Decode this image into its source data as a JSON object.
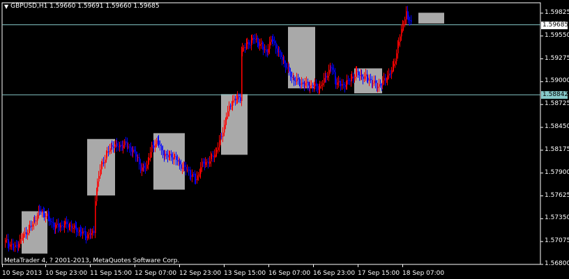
{
  "header": {
    "dropdown_icon": "triangle-down-icon",
    "title": "GBPUSD,H1  1.59660 1.59691 1.59660 1.59685"
  },
  "copyright": "MetaTrader 4, ? 2001-2013, MetaQuotes Software Corp.",
  "price_axis": {
    "ticks": [
      "1.59825",
      "1.59550",
      "1.59275",
      "1.59000",
      "1.58725",
      "1.58450",
      "1.58175",
      "1.57900",
      "1.57625",
      "1.57350",
      "1.57075",
      "1.56800"
    ],
    "current_price": "1.59685",
    "level_price": "1.58842"
  },
  "time_axis": {
    "ticks": [
      "10 Sep 2013",
      "10 Sep 23:00",
      "11 Sep 15:00",
      "12 Sep 07:00",
      "12 Sep 23:00",
      "13 Sep 15:00",
      "16 Sep 07:00",
      "16 Sep 23:00",
      "17 Sep 15:00",
      "18 Sep 07:00"
    ]
  },
  "colors": {
    "background": "#000000",
    "bull_candle": "#ff0000",
    "bear_candle": "#0000ff",
    "range_box": "#a9a9a9",
    "horizontal_line": "#86c8c8",
    "axis": "#ffffff"
  },
  "chart_data": {
    "type": "candlestick",
    "symbol": "GBPUSD",
    "timeframe": "H1",
    "ylim": [
      1.568,
      1.5995
    ],
    "x": [
      "10 Sep 2013",
      "10 Sep 23:00",
      "11 Sep 15:00",
      "12 Sep 07:00",
      "12 Sep 23:00",
      "13 Sep 15:00",
      "16 Sep 07:00",
      "16 Sep 23:00",
      "17 Sep 15:00",
      "18 Sep 07:00"
    ],
    "anchors": [
      [
        0,
        1.5708
      ],
      [
        8,
        1.57
      ],
      [
        15,
        1.5715
      ],
      [
        22,
        1.5728
      ],
      [
        28,
        1.5745
      ],
      [
        34,
        1.5738
      ],
      [
        40,
        1.5725
      ],
      [
        50,
        1.5728
      ],
      [
        58,
        1.5722
      ],
      [
        66,
        1.5715
      ],
      [
        72,
        1.5718
      ],
      [
        73,
        1.576
      ],
      [
        77,
        1.5795
      ],
      [
        82,
        1.5812
      ],
      [
        87,
        1.5824
      ],
      [
        92,
        1.5822
      ],
      [
        98,
        1.5825
      ],
      [
        104,
        1.5815
      ],
      [
        108,
        1.5808
      ],
      [
        110,
        1.5795
      ],
      [
        112,
        1.5795
      ],
      [
        115,
        1.58
      ],
      [
        119,
        1.582
      ],
      [
        124,
        1.583
      ],
      [
        127,
        1.5815
      ],
      [
        132,
        1.581
      ],
      [
        137,
        1.581
      ],
      [
        142,
        1.58
      ],
      [
        146,
        1.5796
      ],
      [
        150,
        1.579
      ],
      [
        155,
        1.5782
      ],
      [
        160,
        1.58
      ],
      [
        166,
        1.5805
      ],
      [
        171,
        1.5815
      ],
      [
        176,
        1.5835
      ],
      [
        180,
        1.586
      ],
      [
        185,
        1.5878
      ],
      [
        191,
        1.588
      ],
      [
        192,
        1.5938
      ],
      [
        197,
        1.5945
      ],
      [
        202,
        1.5952
      ],
      [
        207,
        1.5946
      ],
      [
        212,
        1.5935
      ],
      [
        217,
        1.5952
      ],
      [
        222,
        1.5935
      ],
      [
        228,
        1.592
      ],
      [
        233,
        1.5905
      ],
      [
        238,
        1.59
      ],
      [
        243,
        1.5897
      ],
      [
        249,
        1.5895
      ],
      [
        256,
        1.5893
      ],
      [
        260,
        1.5905
      ],
      [
        265,
        1.5918
      ],
      [
        269,
        1.59
      ],
      [
        274,
        1.5895
      ],
      [
        279,
        1.59
      ],
      [
        285,
        1.591
      ],
      [
        290,
        1.5907
      ],
      [
        296,
        1.5903
      ],
      [
        302,
        1.5895
      ],
      [
        306,
        1.5897
      ],
      [
        310,
        1.5905
      ],
      [
        315,
        1.5915
      ],
      [
        318,
        1.5935
      ],
      [
        321,
        1.5955
      ],
      [
        324,
        1.5972
      ],
      [
        326,
        1.5983
      ],
      [
        328,
        1.5975
      ],
      [
        330,
        1.597
      ]
    ],
    "range_boxes": [
      {
        "from": "10 Sep 2013",
        "high": 1.5744,
        "low": 1.5693
      },
      {
        "from": "11 Sep",
        "high": 1.5831,
        "low": 1.5763
      },
      {
        "from": "12 Sep",
        "high": 1.5838,
        "low": 1.577
      },
      {
        "from": "13 Sep",
        "high": 1.5885,
        "low": 1.5812
      },
      {
        "from": "16 Sep",
        "high": 1.5966,
        "low": 1.5892
      },
      {
        "from": "17 Sep",
        "high": 1.5916,
        "low": 1.5886
      },
      {
        "from": "18 Sep",
        "high": 1.5983,
        "low": 1.597
      }
    ],
    "horizontal_lines": [
      1.59685,
      1.58842
    ]
  }
}
